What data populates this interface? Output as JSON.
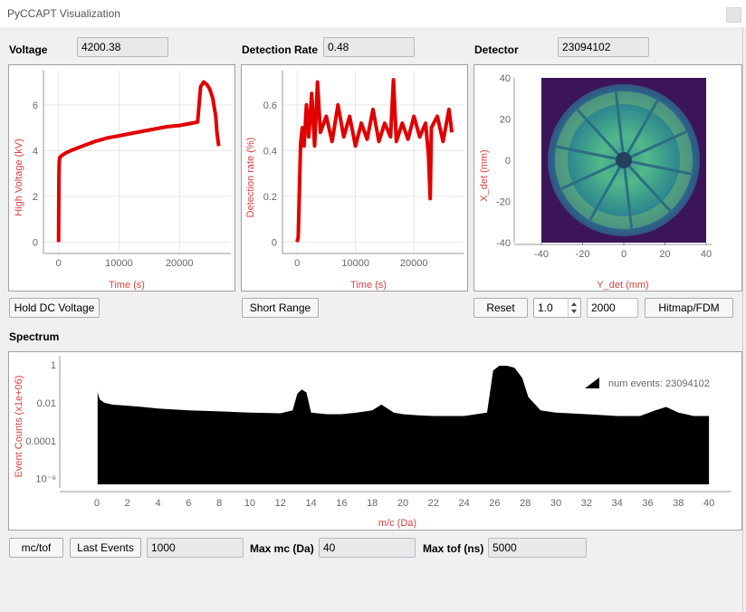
{
  "window": {
    "title": "PyCCAPT Visualization"
  },
  "voltage": {
    "label": "Voltage",
    "value": "4200.38"
  },
  "detection_rate": {
    "label": "Detection Rate",
    "value": "0.48"
  },
  "detector": {
    "label": "Detector",
    "value": "23094102"
  },
  "buttons": {
    "hold_dc": "Hold DC Voltage",
    "short_range": "Short Range",
    "reset": "Reset",
    "hitmap": "Hitmap/FDM",
    "mc_tof": "mc/tof",
    "last_events": "Last Events"
  },
  "hitmap_controls": {
    "scale_value": "1.0",
    "bins_value": "2000"
  },
  "spectrum": {
    "label": "Spectrum",
    "legend": "num events: 23094102"
  },
  "bottom": {
    "last_events_value": "1000",
    "max_mc_label": "Max mc (Da)",
    "max_mc_value": "40",
    "max_tof_label": "Max tof (ns)",
    "max_tof_value": "5000"
  },
  "colors": {
    "plot_red": "#e00000",
    "axis_label_red": "#d94040",
    "hist_black": "#000000"
  },
  "chart_data": [
    {
      "type": "line",
      "title": "",
      "xlabel": "Time (s)",
      "ylabel": "High Voltage (kV)",
      "xlim": [
        -2500,
        28500
      ],
      "ylim": [
        -0.5,
        7.5
      ],
      "xticks": [
        0,
        10000,
        20000
      ],
      "yticks": [
        0,
        2,
        4,
        6
      ],
      "grid": true,
      "series": [
        {
          "x": [
            0,
            30,
            60,
            100,
            200,
            600,
            1200,
            2000,
            4000,
            6000,
            8000,
            10000,
            12000,
            14000,
            16000,
            18000,
            20000,
            22000,
            23000,
            23500,
            24000,
            24500,
            25000,
            25500,
            26000,
            26200,
            26500
          ],
          "y": [
            0,
            1.5,
            2.9,
            3.5,
            3.7,
            3.8,
            3.9,
            4.0,
            4.2,
            4.4,
            4.55,
            4.65,
            4.75,
            4.85,
            4.95,
            5.05,
            5.1,
            5.2,
            5.25,
            6.8,
            7.0,
            6.9,
            6.7,
            6.3,
            5.5,
            4.8,
            4.2
          ]
        }
      ]
    },
    {
      "type": "line",
      "title": "",
      "xlabel": "Time (s)",
      "ylabel": "Detection rate (%)",
      "xlim": [
        -2500,
        28500
      ],
      "ylim": [
        -0.05,
        0.75
      ],
      "xticks": [
        0,
        10000,
        20000
      ],
      "yticks": [
        0,
        0.2,
        0.4,
        0.6
      ],
      "grid": true,
      "series": [
        {
          "x": [
            0,
            200,
            400,
            600,
            900,
            1200,
            1600,
            2000,
            2500,
            3000,
            3500,
            4000,
            5000,
            6000,
            7000,
            8000,
            9000,
            10000,
            11000,
            12000,
            13000,
            14000,
            15000,
            16000,
            16500,
            17000,
            18000,
            19000,
            20000,
            21000,
            22000,
            22500,
            22800,
            23000,
            24000,
            25000,
            26000,
            26500
          ],
          "y": [
            0,
            0.02,
            0.22,
            0.43,
            0.5,
            0.42,
            0.6,
            0.46,
            0.65,
            0.42,
            0.7,
            0.48,
            0.55,
            0.44,
            0.6,
            0.46,
            0.55,
            0.42,
            0.52,
            0.45,
            0.58,
            0.44,
            0.52,
            0.46,
            0.71,
            0.44,
            0.52,
            0.45,
            0.55,
            0.46,
            0.52,
            0.38,
            0.19,
            0.5,
            0.55,
            0.44,
            0.58,
            0.48
          ]
        }
      ]
    },
    {
      "type": "heatmap",
      "title": "",
      "xlabel": "Y_det (mm)",
      "ylabel": "X_det (mm)",
      "xlim": [
        -40,
        40
      ],
      "ylim": [
        -40,
        40
      ],
      "xticks": [
        -40,
        -20,
        0,
        20,
        40
      ],
      "yticks": [
        -40,
        -20,
        0,
        20,
        40
      ],
      "detector_radius_mm": 37,
      "spokes": 10
    },
    {
      "type": "area",
      "title": "",
      "xlabel": "m/c (Da)",
      "ylabel": "Event Counts (x1e+06)",
      "xlim": [
        -1,
        41
      ],
      "ylim": [
        5e-07,
        3
      ],
      "yscale": "log",
      "xticks": [
        0,
        2,
        4,
        6,
        8,
        10,
        12,
        14,
        16,
        18,
        20,
        22,
        24,
        26,
        28,
        30,
        32,
        34,
        36,
        38,
        40
      ],
      "ytick_labels": [
        "1",
        "0.01",
        "0.0001",
        "10⁻⁶"
      ],
      "ytick_values": [
        1,
        0.01,
        0.0001,
        1e-06
      ],
      "legend_position": "top-right",
      "series": [
        {
          "name": "num events: 23094102",
          "x": [
            0.05,
            0.1,
            0.2,
            0.5,
            1,
            2,
            3,
            4,
            6,
            8,
            10,
            12,
            12.8,
            13.1,
            13.4,
            13.7,
            14,
            15,
            16,
            17,
            18,
            18.6,
            19,
            19.4,
            20,
            21,
            22,
            24,
            25.5,
            25.9,
            26.3,
            26.8,
            27.3,
            27.8,
            28.2,
            29,
            30,
            32,
            34,
            35.5,
            36.5,
            37.2,
            38,
            39,
            40
          ],
          "y": [
            0.04,
            0.025,
            0.015,
            0.01,
            0.008,
            0.007,
            0.006,
            0.005,
            0.004,
            0.0035,
            0.003,
            0.0028,
            0.004,
            0.03,
            0.05,
            0.035,
            0.003,
            0.0025,
            0.0025,
            0.003,
            0.004,
            0.008,
            0.005,
            0.003,
            0.0025,
            0.0022,
            0.002,
            0.002,
            0.003,
            0.5,
            0.9,
            0.9,
            0.7,
            0.2,
            0.02,
            0.004,
            0.003,
            0.0025,
            0.002,
            0.002,
            0.004,
            0.006,
            0.003,
            0.002,
            0.002
          ]
        }
      ]
    }
  ]
}
